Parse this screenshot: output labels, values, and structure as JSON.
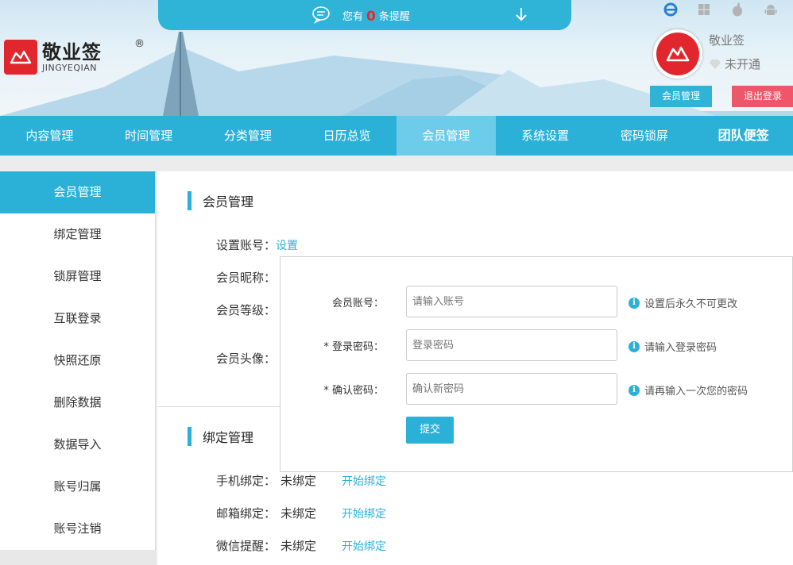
{
  "header": {
    "notification": {
      "prefix": "您有",
      "count": "0",
      "suffix": "条提醒"
    },
    "logo": {
      "cn": "敬业签",
      "en": "JINGYEQIAN",
      "reg": "®"
    },
    "platforms": [
      "ie-icon",
      "windows-icon",
      "apple-icon",
      "android-icon"
    ],
    "user": {
      "name": "敬业签",
      "status": "未开通"
    },
    "member_button": "会员管理",
    "logout_button": "退出登录"
  },
  "nav": {
    "items": [
      "内容管理",
      "时间管理",
      "分类管理",
      "日历总览",
      "会员管理",
      "系统设置",
      "密码锁屏",
      "团队便签"
    ],
    "active_index": 4
  },
  "sidebar": {
    "items": [
      "会员管理",
      "绑定管理",
      "锁屏管理",
      "互联登录",
      "快照还原",
      "删除数据",
      "数据导入",
      "账号归属",
      "账号注销"
    ],
    "active_index": 0
  },
  "member_section": {
    "title": "会员管理",
    "account_label": "设置账号：",
    "account_link": "设置",
    "nickname_label": "会员昵称：",
    "level_label": "会员等级：",
    "avatar_label": "会员头像："
  },
  "popup": {
    "account": {
      "label": "会员账号：",
      "placeholder": "请输入账号",
      "hint": "设置后永久不可更改"
    },
    "password": {
      "label": "* 登录密码：",
      "placeholder": "登录密码",
      "hint": "请输入登录密码"
    },
    "confirm": {
      "label": "* 确认密码：",
      "placeholder": "确认新密码",
      "hint": "请再输入一次您的密码"
    },
    "submit": "提交"
  },
  "bind_section": {
    "title": "绑定管理",
    "rows": [
      {
        "label": "手机绑定：",
        "status": "未绑定",
        "action": "开始绑定"
      },
      {
        "label": "邮箱绑定：",
        "status": "未绑定",
        "action": "开始绑定"
      },
      {
        "label": "微信提醒：",
        "status": "未绑定",
        "action": "开始绑定"
      }
    ]
  },
  "colors": {
    "primary": "#2bb1d7",
    "active_nav": "#6dcce9",
    "logout": "#f0566a",
    "brand_red": "#e2262d"
  }
}
